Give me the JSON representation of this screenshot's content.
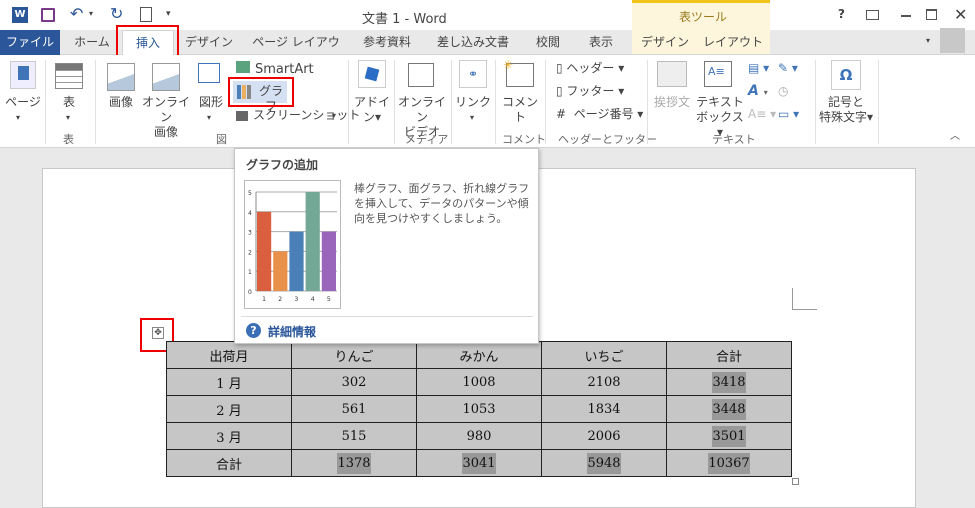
{
  "window": {
    "title": "文書 1 - Word",
    "context_tool": "表ツール"
  },
  "tabs": [
    {
      "label": "ファイル"
    },
    {
      "label": "ホーム"
    },
    {
      "label": "挿入"
    },
    {
      "label": "デザイン"
    },
    {
      "label": "ページ レイアウト"
    },
    {
      "label": "参考資料"
    },
    {
      "label": "差し込み文書"
    },
    {
      "label": "校閲"
    },
    {
      "label": "表示"
    },
    {
      "label": "デザイン"
    },
    {
      "label": "レイアウト"
    }
  ],
  "ribbon": {
    "page": "ページ",
    "table": "表",
    "image": "画像",
    "online_image_1": "オンライン",
    "online_image_2": "画像",
    "shapes": "図形",
    "smartart": "SmartArt",
    "chart": "グラフ",
    "screenshot": "スクリーンショット",
    "addin_1": "アドイ",
    "addin_2": "ン",
    "online_video_1": "オンライン",
    "online_video_2": "ビデオ",
    "link": "リンク",
    "comment": "コメント",
    "header": "ヘッダー",
    "footer": "フッター",
    "page_number": "ページ番号",
    "greeting": "挨拶文",
    "textbox_1": "テキスト",
    "textbox_2": "ボックス",
    "symbol_1": "記号と",
    "symbol_2": "特殊文字",
    "groups": {
      "table": "表",
      "illustrations": "図",
      "media": "メディア",
      "comment": "コメント",
      "header_footer": "ヘッダーとフッター",
      "text": "テキスト"
    }
  },
  "tooltip": {
    "title": "グラフの追加",
    "description": "棒グラフ、面グラフ、折れ線グラフを挿入して、データのパターンや傾向を見つけやすくしましょう。",
    "more_info": "詳細情報",
    "chart_data": {
      "type": "bar",
      "categories": [
        "1",
        "2",
        "3",
        "4",
        "5"
      ],
      "values": [
        4,
        2,
        3,
        5,
        3
      ],
      "ylim": [
        0,
        5
      ],
      "y_ticks": [
        "0",
        "1",
        "2",
        "3",
        "4",
        "5"
      ],
      "colors": [
        "#d95f3f",
        "#e8914a",
        "#4a7fb8",
        "#74a896",
        "#9966bb"
      ]
    }
  },
  "table": {
    "header": [
      "出荷月",
      "りんご",
      "みかん",
      "いちご",
      "合計"
    ],
    "rows": [
      [
        "1 月",
        "302",
        "1008",
        "2108",
        "3418"
      ],
      [
        "2 月",
        "561",
        "1053",
        "1834",
        "3448"
      ],
      [
        "3 月",
        "515",
        "980",
        "2006",
        "3501"
      ],
      [
        "合計",
        "1378",
        "3041",
        "5948",
        "10367"
      ]
    ]
  },
  "colors": {
    "accent": "#2b579a",
    "highlight_box": "#e00000",
    "context_tab": "#fdf6dc"
  }
}
